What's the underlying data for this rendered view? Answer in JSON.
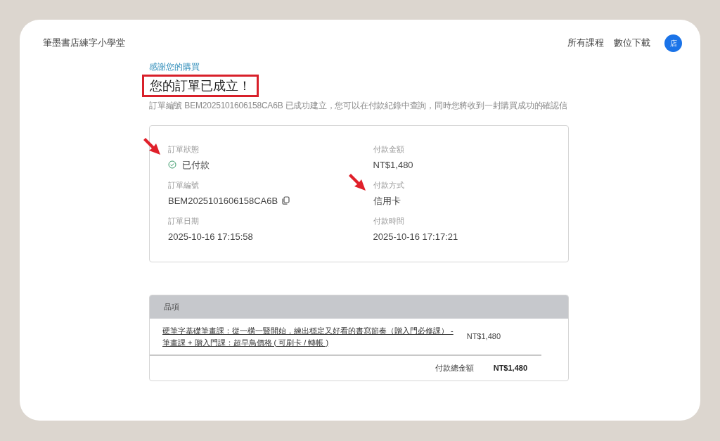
{
  "header": {
    "brand": "筆墨書店練字小學堂",
    "nav": [
      {
        "label": "所有課程"
      },
      {
        "label": "數位下載"
      }
    ],
    "avatar": "店"
  },
  "intro": {
    "eyebrow": "感謝您的購買",
    "title": "您的訂單已成立！",
    "highlighted": true,
    "description": "訂單編號 BEM2025101606158CA6B 已成功建立，您可以在付款紀錄中查詢，同時您將收到一封購買成功的確認信"
  },
  "details": [
    {
      "label": "訂單狀態",
      "value": "已付款",
      "kind": "status",
      "arrow": true
    },
    {
      "label": "付款金額",
      "value": "NT$1,480",
      "kind": "plain",
      "arrow": false
    },
    {
      "label": "訂單編號",
      "value": "BEM2025101606158CA6B",
      "kind": "copy",
      "arrow": false
    },
    {
      "label": "付款方式",
      "value": "信用卡",
      "kind": "plain",
      "arrow": true
    },
    {
      "label": "訂單日期",
      "value": "2025-10-16 17:15:58",
      "kind": "plain",
      "arrow": false
    },
    {
      "label": "付款時間",
      "value": "2025-10-16 17:17:21",
      "kind": "plain",
      "arrow": false
    }
  ],
  "items_table": {
    "heading": "品項",
    "rows": [
      {
        "name": "硬筆字基礎筆畫課：從一橫一豎開始，練出穩定又好看的書寫節奏（贈入門必修課） - 筆畫課 + 贈入門課：超早鳥價格 ( 可刷卡 / 轉帳 )",
        "price": "NT$1,480"
      }
    ],
    "total_label": "付款總金額",
    "total": "NT$1,480"
  }
}
